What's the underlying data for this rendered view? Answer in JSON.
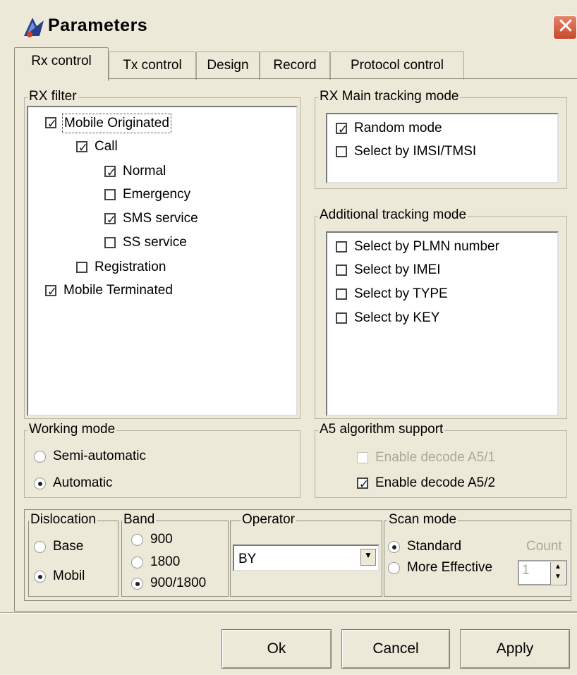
{
  "window": {
    "title": "Parameters",
    "close_glyph": "✕",
    "icon": "app-logo-icon"
  },
  "tabs": [
    {
      "label": "Rx control",
      "active": true
    },
    {
      "label": "Tx control",
      "active": false
    },
    {
      "label": "Design",
      "active": false
    },
    {
      "label": "Record",
      "active": false
    },
    {
      "label": "Protocol control",
      "active": false
    }
  ],
  "rx_filter": {
    "label": "RX filter",
    "items": [
      {
        "label": "Mobile Originated",
        "checked": true
      },
      {
        "label": "Call",
        "checked": true
      },
      {
        "label": "Normal",
        "checked": true
      },
      {
        "label": "Emergency",
        "checked": false
      },
      {
        "label": "SMS service",
        "checked": true
      },
      {
        "label": "SS service",
        "checked": false
      },
      {
        "label": "Registration",
        "checked": false
      },
      {
        "label": "Mobile Terminated",
        "checked": true
      }
    ]
  },
  "rx_main_tracking": {
    "label": "RX Main tracking mode",
    "items": [
      {
        "label": "Random mode",
        "checked": true
      },
      {
        "label": "Select by IMSI/TMSI",
        "checked": false
      }
    ]
  },
  "additional_tracking": {
    "label": "Additional tracking mode",
    "items": [
      {
        "label": "Select by PLMN number",
        "checked": false
      },
      {
        "label": "Select by IMEI",
        "checked": false
      },
      {
        "label": "Select by TYPE",
        "checked": false
      },
      {
        "label": "Select by KEY",
        "checked": false
      }
    ]
  },
  "working_mode": {
    "label": "Working mode",
    "options": [
      {
        "label": "Semi-automatic",
        "selected": false
      },
      {
        "label": "Automatic",
        "selected": true
      }
    ]
  },
  "a5_support": {
    "label": "A5 algorithm support",
    "items": [
      {
        "label": "Enable decode A5/1",
        "checked": false,
        "enabled": false
      },
      {
        "label": "Enable decode A5/2",
        "checked": true,
        "enabled": true
      }
    ]
  },
  "dislocation": {
    "label": "Dislocation",
    "options": [
      {
        "label": "Base",
        "selected": false
      },
      {
        "label": "Mobil",
        "selected": true
      }
    ]
  },
  "band": {
    "label": "Band",
    "options": [
      {
        "label": "900",
        "selected": false
      },
      {
        "label": "1800",
        "selected": false
      },
      {
        "label": "900/1800",
        "selected": true
      }
    ]
  },
  "operator": {
    "label": "Operator",
    "value": "BY"
  },
  "scan_mode": {
    "label": "Scan mode",
    "options": [
      {
        "label": "Standard",
        "selected": true
      },
      {
        "label": "More Effective",
        "selected": false
      }
    ],
    "count_label": "Count",
    "count_value": "1"
  },
  "buttons": {
    "ok": "Ok",
    "cancel": "Cancel",
    "apply": "Apply"
  }
}
